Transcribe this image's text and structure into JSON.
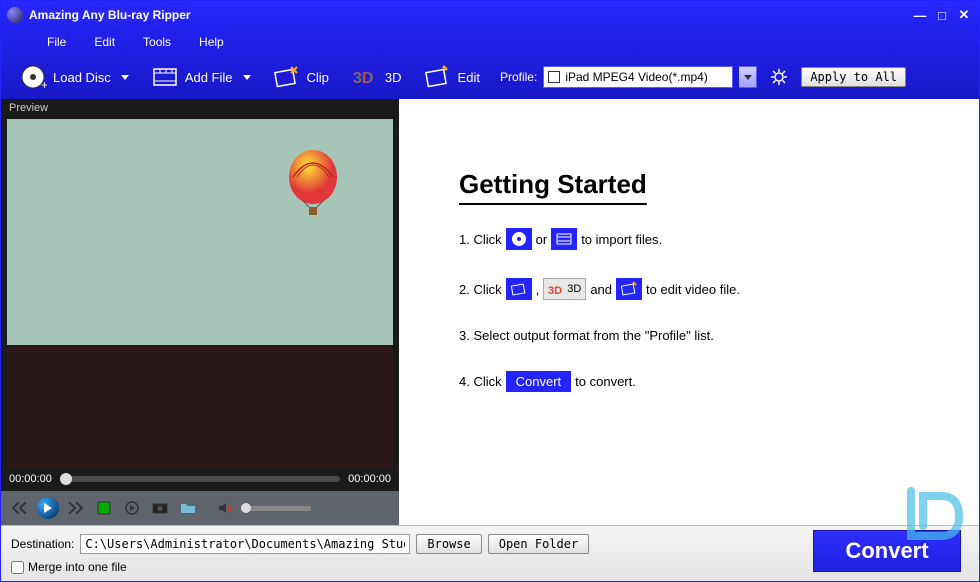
{
  "window": {
    "title": "Amazing Any Blu-ray Ripper"
  },
  "menu": {
    "file": "File",
    "edit": "Edit",
    "tools": "Tools",
    "help": "Help"
  },
  "toolbar": {
    "load_disc": "Load Disc",
    "add_file": "Add File",
    "clip": "Clip",
    "three_d": "3D",
    "edit": "Edit",
    "profile_label": "Profile:",
    "profile_value": "iPad MPEG4 Video(*.mp4)",
    "apply_all": "Apply to All"
  },
  "preview": {
    "label": "Preview",
    "time_start": "00:00:00",
    "time_end": "00:00:00"
  },
  "content": {
    "heading": "Getting Started",
    "step1_a": "1. Click",
    "step1_or": "or",
    "step1_b": "to import files.",
    "step2_a": "2. Click",
    "step2_comma": ",",
    "step2_and": "and",
    "step2_b": "to edit video file.",
    "step2_3d": "3D",
    "step3": "3. Select output format from the \"Profile\" list.",
    "step4_a": "4. Click",
    "step4_convert": "Convert",
    "step4_b": "to convert."
  },
  "bottom": {
    "dest_label": "Destination:",
    "dest_value": "C:\\Users\\Administrator\\Documents\\Amazing Studio\\",
    "browse": "Browse",
    "open_folder": "Open Folder",
    "merge": "Merge into one file",
    "convert": "Convert"
  }
}
